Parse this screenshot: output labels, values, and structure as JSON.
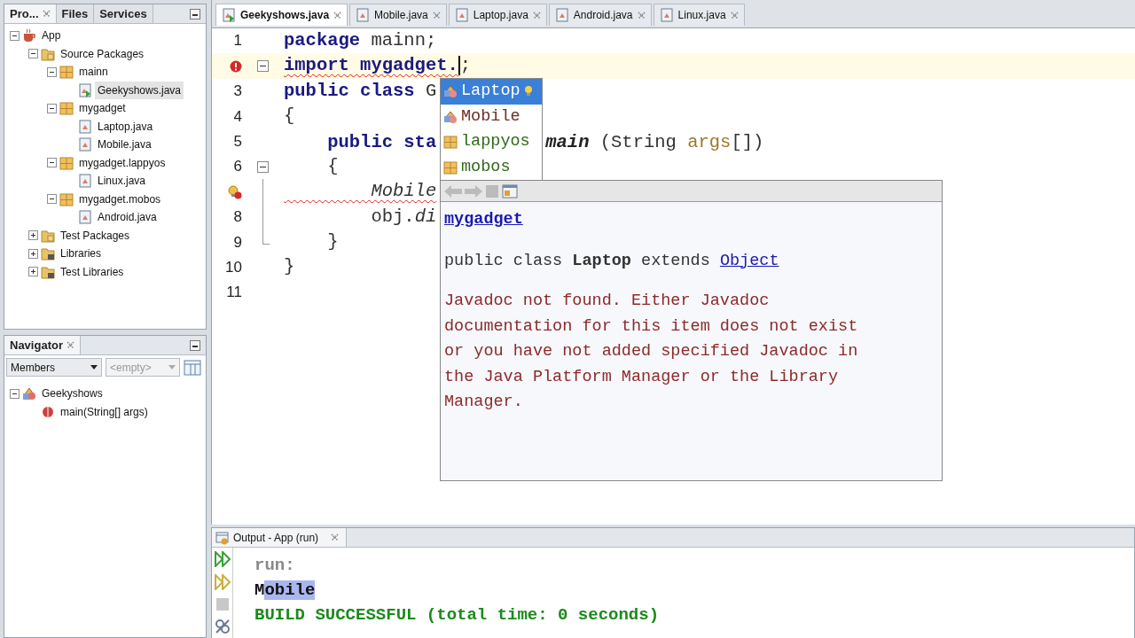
{
  "project_panel": {
    "tabs": [
      {
        "label": "Pro...",
        "selected": true
      },
      {
        "label": "Files",
        "selected": false
      },
      {
        "label": "Services",
        "selected": false
      }
    ],
    "tree": [
      {
        "label": "App",
        "kind": "project",
        "expanded": true,
        "selected": false,
        "children": [
          {
            "label": "Source Packages",
            "kind": "source-folder",
            "expanded": true,
            "selected": false,
            "children": [
              {
                "label": "mainn",
                "kind": "package",
                "expanded": true,
                "selected": false,
                "children": [
                  {
                    "label": "Geekyshows.java",
                    "kind": "main-file",
                    "selected": true
                  }
                ]
              },
              {
                "label": "mygadget",
                "kind": "package",
                "expanded": true,
                "selected": false,
                "children": [
                  {
                    "label": "Laptop.java",
                    "kind": "file",
                    "selected": false
                  },
                  {
                    "label": "Mobile.java",
                    "kind": "file",
                    "selected": false
                  }
                ]
              },
              {
                "label": "mygadget.lappyos",
                "kind": "package",
                "expanded": true,
                "selected": false,
                "children": [
                  {
                    "label": "Linux.java",
                    "kind": "file",
                    "selected": false
                  }
                ]
              },
              {
                "label": "mygadget.mobos",
                "kind": "package",
                "expanded": true,
                "selected": false,
                "children": [
                  {
                    "label": "Android.java",
                    "kind": "file",
                    "selected": false
                  }
                ]
              }
            ]
          },
          {
            "label": "Test Packages",
            "kind": "test-folder",
            "expanded": false,
            "selected": false
          },
          {
            "label": "Libraries",
            "kind": "library",
            "expanded": false,
            "selected": false
          },
          {
            "label": "Test Libraries",
            "kind": "library",
            "expanded": false,
            "selected": false
          }
        ]
      }
    ]
  },
  "navigator": {
    "title": "Navigator",
    "view_select": "Members",
    "filter_select": {
      "value": "<empty>",
      "disabled": true
    },
    "tree": [
      {
        "label": "Geekyshows",
        "kind": "class",
        "expanded": true,
        "children": [
          {
            "label": "main(String[] args)",
            "kind": "method"
          }
        ]
      }
    ]
  },
  "editor": {
    "tabs": [
      {
        "label": "Geekyshows.java",
        "kind": "main-file",
        "selected": true
      },
      {
        "label": "Mobile.java",
        "kind": "file",
        "selected": false
      },
      {
        "label": "Laptop.java",
        "kind": "file",
        "selected": false
      },
      {
        "label": "Android.java",
        "kind": "file",
        "selected": false
      },
      {
        "label": "Linux.java",
        "kind": "file",
        "selected": false
      }
    ],
    "lines": [
      {
        "number": "1",
        "highlighted": false,
        "parts": [
          {
            "text": "package",
            "kind": "keyword"
          },
          {
            "text": " mainn;",
            "kind": "plain"
          }
        ]
      },
      {
        "marker": {
          "kind": "error"
        },
        "fold": {
          "kind": "open"
        },
        "highlighted": true,
        "parts": [
          {
            "text": "import mygadget.",
            "kind": "keyword-lead",
            "error": true,
            "caret": true
          },
          {
            "text": ";",
            "kind": "plain"
          }
        ]
      },
      {
        "number": "3",
        "highlighted": false,
        "parts": [
          {
            "text": "public class",
            "kind": "keyword"
          },
          {
            "text": " G",
            "kind": "plain"
          }
        ]
      },
      {
        "number": "4",
        "highlighted": false,
        "parts": [
          {
            "text": "{",
            "kind": "plain"
          }
        ]
      },
      {
        "number": "5",
        "highlighted": false,
        "parts": [
          {
            "text": "    public sta",
            "kind": "keyword"
          },
          {
            "text": "main",
            "kind": "method",
            "after_popup": true
          },
          {
            "text": " (String ",
            "kind": "plain",
            "after_popup": true
          },
          {
            "text": "args",
            "kind": "param",
            "after_popup": true
          },
          {
            "text": "[])",
            "kind": "plain",
            "after_popup": true
          }
        ]
      },
      {
        "number": "6",
        "fold": {
          "kind": "open"
        },
        "highlighted": false,
        "parts": [
          {
            "text": "    {",
            "kind": "plain"
          }
        ]
      },
      {
        "marker": {
          "kind": "hint-error"
        },
        "fold": {
          "kind": "line"
        },
        "highlighted": false,
        "parts": [
          {
            "text": "        Mobile",
            "kind": "type",
            "error": true
          }
        ]
      },
      {
        "number": "8",
        "fold": {
          "kind": "line"
        },
        "highlighted": false,
        "parts": [
          {
            "text": "        obj.",
            "kind": "plain"
          },
          {
            "text": "di",
            "kind": "italic"
          }
        ]
      },
      {
        "number": "9",
        "fold": {
          "kind": "end"
        },
        "highlighted": false,
        "parts": [
          {
            "text": "    }",
            "kind": "plain"
          }
        ]
      },
      {
        "number": "10",
        "highlighted": false,
        "parts": [
          {
            "text": "}",
            "kind": "plain"
          }
        ]
      },
      {
        "number": "11",
        "highlighted": false
      }
    ],
    "completion": [
      {
        "label": "Laptop",
        "kind": "class",
        "selected": true
      },
      {
        "label": "Mobile",
        "kind": "class",
        "selected": false
      },
      {
        "label": "lappyos",
        "kind": "package",
        "selected": false
      },
      {
        "label": "mobos",
        "kind": "package",
        "selected": false
      }
    ],
    "doc": {
      "package_link": "mygadget",
      "signature": "public class **Laptop** extends ",
      "signature_link": "Object",
      "message": "Javadoc not found. Either Javadoc documentation for this item does not exist or you have not added specified Javadoc in the Java Platform Manager or the Library Manager."
    }
  },
  "output": {
    "title": "Output - App (run)",
    "toolbar": [
      {
        "kind": "rerun",
        "disabled": false
      },
      {
        "kind": "rerun-options",
        "disabled": false
      },
      {
        "kind": "stop",
        "disabled": true
      },
      {
        "kind": "settings",
        "disabled": false
      }
    ],
    "lines": [
      {
        "kind": "muted",
        "parts": [
          {
            "text": "run:",
            "selected": false
          }
        ]
      },
      {
        "kind": "normal",
        "parts": [
          {
            "text": "M",
            "selected": false
          },
          {
            "text": "obile",
            "selected": true
          }
        ]
      },
      {
        "kind": "success",
        "parts": [
          {
            "text": "BUILD SUCCESSFUL (total time: 0 seconds)",
            "selected": false
          }
        ]
      }
    ]
  }
}
